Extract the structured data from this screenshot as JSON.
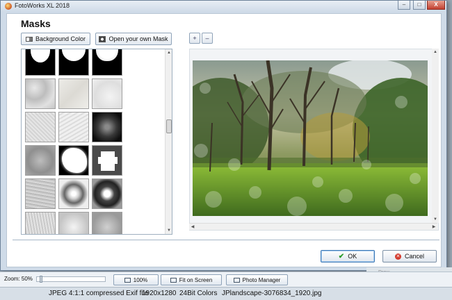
{
  "window": {
    "title": "FotoWorks XL 2018",
    "controls": [
      "–",
      "□",
      "X"
    ]
  },
  "dialog": {
    "heading": "Masks",
    "background_color_label": "Background Color",
    "open_mask_label": "Open your own Mask",
    "zoom_in_symbol": "+",
    "zoom_out_symbol": "–",
    "ok_label": "OK",
    "cancel_label": "Cancel"
  },
  "mask_thumbnails": [
    "white-circle",
    "white-circle",
    "white-circle",
    "light-texture",
    "light-texture",
    "light-texture",
    "light-texture",
    "light-texture",
    "dark-grunge",
    "grey-texture",
    "white-cloud",
    "white-puzzle",
    "grey-streaks",
    "grey-splash",
    "dark-splash",
    "grey-texture",
    "grey-texture",
    "grey-texture"
  ],
  "main_toolbar": {
    "zoom_text": "Zoom: 50%",
    "btn_100": "100%",
    "btn_fit": "Fit on Screen",
    "btn_photo_manager": "Photo Manager"
  },
  "background_hint": "Draw",
  "status": {
    "format": "JPEG 4:1:1 compressed Exif file",
    "resolution": "1920x1280",
    "colors": "24Bit Colors",
    "filename": "JPlandscape-3076834_1920.jpg"
  },
  "colors": {
    "dialog_bg": "#cfdbe8",
    "accent": "#3f79b5",
    "cancel_red": "#d33a2c",
    "ok_green": "#2a9b2a"
  }
}
